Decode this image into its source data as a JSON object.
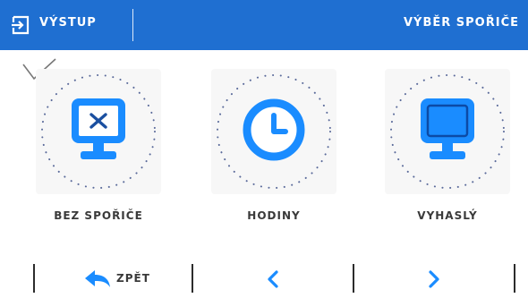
{
  "header": {
    "exit_label": "VÝSTUP",
    "title": "VÝBĚR SPOŘIČE",
    "background_color": "#1f6fd1"
  },
  "selection_mark": "check-icon",
  "options": [
    {
      "label": "BEZ SPOŘIČE",
      "icon": "monitor-x-icon",
      "selected": true
    },
    {
      "label": "HODINY",
      "icon": "clock-icon",
      "selected": false
    },
    {
      "label": "VYHASLÝ",
      "icon": "monitor-blank-icon",
      "selected": false
    }
  ],
  "footer": {
    "back_label": "ZPĚT",
    "back_icon": "reply-arrow-icon",
    "prev_icon": "chevron-left-icon",
    "next_icon": "chevron-right-icon"
  },
  "accent_color": "#1a8cff"
}
